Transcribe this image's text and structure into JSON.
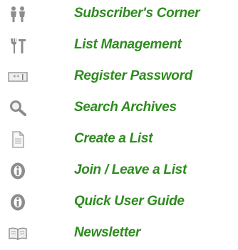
{
  "menu": {
    "link_color": "#2e8b1f",
    "icon_color": "#8c8c8c",
    "items": [
      {
        "label": "Subscriber's Corner",
        "icon": "people-icon"
      },
      {
        "label": "List Management",
        "icon": "tools-icon"
      },
      {
        "label": "Register Password",
        "icon": "password-field-icon"
      },
      {
        "label": "Search Archives",
        "icon": "magnifier-icon"
      },
      {
        "label": "Create a List",
        "icon": "document-icon"
      },
      {
        "label": "Join / Leave a List",
        "icon": "join-leave-icon"
      },
      {
        "label": "Quick User Guide",
        "icon": "info-icon"
      },
      {
        "label": "Newsletter",
        "icon": "open-book-icon"
      }
    ]
  }
}
